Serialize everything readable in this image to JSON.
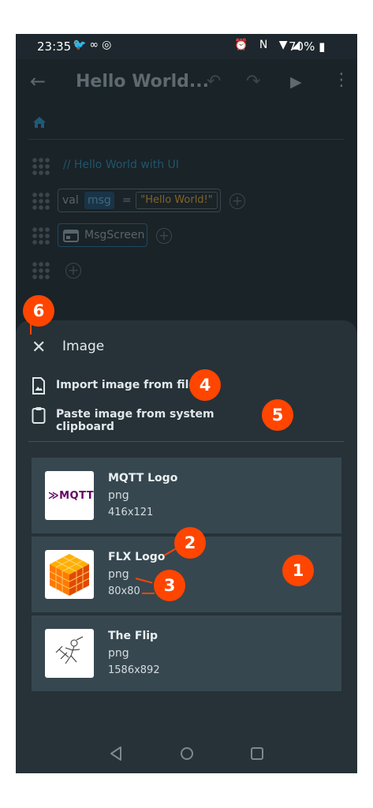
{
  "status_bar": {
    "time": "23:35",
    "battery": "70%"
  },
  "app_bar": {
    "title": "Hello World..."
  },
  "code": {
    "comment": "// Hello World with UI",
    "val_keyword": "val",
    "variable_name": "msg",
    "equals": "=",
    "string_value": "\"Hello World!\"",
    "screen_block": "MsgScreen"
  },
  "sheet": {
    "title": "Image",
    "import_label": "Import image from file",
    "paste_label": "Paste image from system clipboard",
    "images": [
      {
        "name": "MQTT Logo",
        "format": "png",
        "dimensions": "416x121",
        "thumb_text": "MQTT"
      },
      {
        "name": "FLX Logo",
        "format": "png",
        "dimensions": "80x80"
      },
      {
        "name": "The Flip",
        "format": "png",
        "dimensions": "1586x892"
      }
    ]
  },
  "callouts": [
    "1",
    "2",
    "3",
    "4",
    "5",
    "6"
  ],
  "colors": {
    "callout": "#ff4500",
    "sheet": "#263238",
    "card": "#37474f",
    "editor": "#1a2328"
  }
}
